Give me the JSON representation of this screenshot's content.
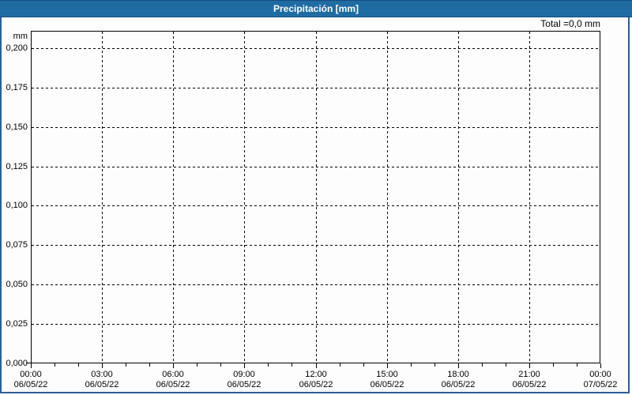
{
  "window": {
    "title": "Precipitación [mm]"
  },
  "colors": {
    "titlebar_bg": "#1F6CA3",
    "window_border": "#2B5F94",
    "grid": "#000000",
    "plot_bg": "#FDFDFD",
    "title_text": "#FFFFFF",
    "label_text": "#000000"
  },
  "chart_data": {
    "type": "line",
    "title": "Precipitación [mm]",
    "total_annotation": "Total =0,0 mm",
    "grid": "dashed",
    "series": [],
    "y_axis": {
      "unit_label": "mm",
      "min": 0,
      "axis_max": 0.211,
      "ticks": [
        {
          "value": 0.2,
          "label": "0,200"
        },
        {
          "value": 0.175,
          "label": "0,175"
        },
        {
          "value": 0.15,
          "label": "0,150"
        },
        {
          "value": 0.125,
          "label": "0,125"
        },
        {
          "value": 0.1,
          "label": "0,100"
        },
        {
          "value": 0.075,
          "label": "0,075"
        },
        {
          "value": 0.05,
          "label": "0,050"
        },
        {
          "value": 0.025,
          "label": "0,025"
        },
        {
          "value": 0.0,
          "label": "0,000"
        }
      ]
    },
    "x_axis": {
      "range_hours": [
        0,
        24
      ],
      "minor_tick_hours": 1,
      "major_ticks": [
        {
          "hour": 0,
          "time": "00:00",
          "date": "06/05/22"
        },
        {
          "hour": 3,
          "time": "03:00",
          "date": "06/05/22"
        },
        {
          "hour": 6,
          "time": "06:00",
          "date": "06/05/22"
        },
        {
          "hour": 9,
          "time": "09:00",
          "date": "06/05/22"
        },
        {
          "hour": 12,
          "time": "12:00",
          "date": "06/05/22"
        },
        {
          "hour": 15,
          "time": "15:00",
          "date": "06/05/22"
        },
        {
          "hour": 18,
          "time": "18:00",
          "date": "06/05/22"
        },
        {
          "hour": 21,
          "time": "21:00",
          "date": "06/05/22"
        },
        {
          "hour": 24,
          "time": "00:00",
          "date": "07/05/22"
        }
      ]
    }
  }
}
